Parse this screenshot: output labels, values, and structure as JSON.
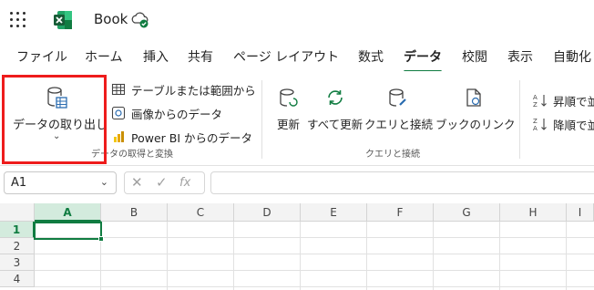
{
  "app": {
    "title": "Book"
  },
  "menu": {
    "tabs": [
      {
        "label": "ファイル"
      },
      {
        "label": "ホーム"
      },
      {
        "label": "挿入"
      },
      {
        "label": "共有"
      },
      {
        "label": "ページ レイアウト"
      },
      {
        "label": "数式"
      },
      {
        "label": "データ",
        "active": true
      },
      {
        "label": "校閲"
      },
      {
        "label": "表示"
      },
      {
        "label": "自動化"
      }
    ]
  },
  "ribbon": {
    "get_data": {
      "label": "データの取り出し",
      "caret": "⌄"
    },
    "get_transform_group": {
      "items": [
        {
          "label": "テーブルまたは範囲から"
        },
        {
          "label": "画像からのデータ"
        },
        {
          "label": "Power BI からのデータ"
        }
      ],
      "group_label": "データの取得と変換"
    },
    "queries_group": {
      "items": [
        {
          "label": "更新"
        },
        {
          "label": "すべて更新"
        },
        {
          "label": "クエリと接続"
        },
        {
          "label": "ブックのリンク"
        }
      ],
      "group_label": "クエリと接続"
    },
    "sort_group": {
      "items": [
        {
          "label": "昇順で並"
        },
        {
          "label": "降順で並"
        }
      ]
    }
  },
  "formula_bar": {
    "name_box": "A1",
    "fx_label": "fx"
  },
  "grid": {
    "columns": [
      "A",
      "B",
      "C",
      "D",
      "E",
      "F",
      "G",
      "H",
      "I"
    ],
    "rows": [
      "1",
      "2",
      "3",
      "4"
    ],
    "active_cell": "A1"
  },
  "colors": {
    "accent": "#107c41",
    "highlight": "#ee1c1c"
  }
}
